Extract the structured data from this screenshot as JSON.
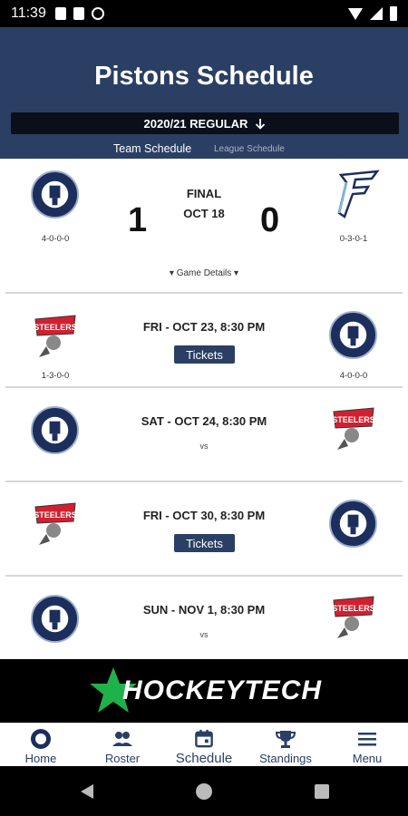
{
  "status": {
    "time": "11:39"
  },
  "header": {
    "title": "Pistons Schedule",
    "season_label": "2020/21 REGULAR",
    "tabs": [
      {
        "label": "Team Schedule"
      },
      {
        "label": "League Schedule"
      }
    ]
  },
  "games": [
    {
      "status": "FINAL",
      "date": "OCT 18",
      "home_score": "1",
      "away_score": "0",
      "left_record": "4-0-0-0",
      "right_record": "0-3-0-1",
      "details_label": "Game Details",
      "left_logo": "steinbach-pistons-logo",
      "right_logo": "falcons-logo"
    },
    {
      "datetime": "FRI - OCT 23, 8:30 PM",
      "tickets_label": "Tickets",
      "left_record": "1-3-0-0",
      "right_record": "4-0-0-0",
      "left_logo": "steelers-logo",
      "right_logo": "steinbach-pistons-logo"
    },
    {
      "datetime": "SAT - OCT 24, 8:30 PM",
      "vs_label": "vs",
      "left_logo": "steinbach-pistons-logo",
      "right_logo": "steelers-logo"
    },
    {
      "datetime": "FRI - OCT 30, 8:30 PM",
      "tickets_label": "Tickets",
      "left_logo": "steelers-logo",
      "right_logo": "steinbach-pistons-logo"
    },
    {
      "datetime": "SUN - NOV 1, 8:30 PM",
      "vs_label": "vs",
      "left_logo": "steinbach-pistons-logo",
      "right_logo": "steelers-logo"
    }
  ],
  "ad": {
    "text": "HOCKEYTECH"
  },
  "bottom_nav": [
    {
      "label": "Home",
      "icon": "home-logo-icon"
    },
    {
      "label": "Roster",
      "icon": "people-icon"
    },
    {
      "label": "Schedule",
      "icon": "calendar-icon",
      "active": true
    },
    {
      "label": "Standings",
      "icon": "trophy-icon"
    },
    {
      "label": "Menu",
      "icon": "menu-icon"
    }
  ],
  "colors": {
    "primary": "#2a3f63",
    "pistons_navy": "#1c2f5c",
    "steelers_red": "#d22030",
    "hockeytech_green": "#1fb24b"
  }
}
